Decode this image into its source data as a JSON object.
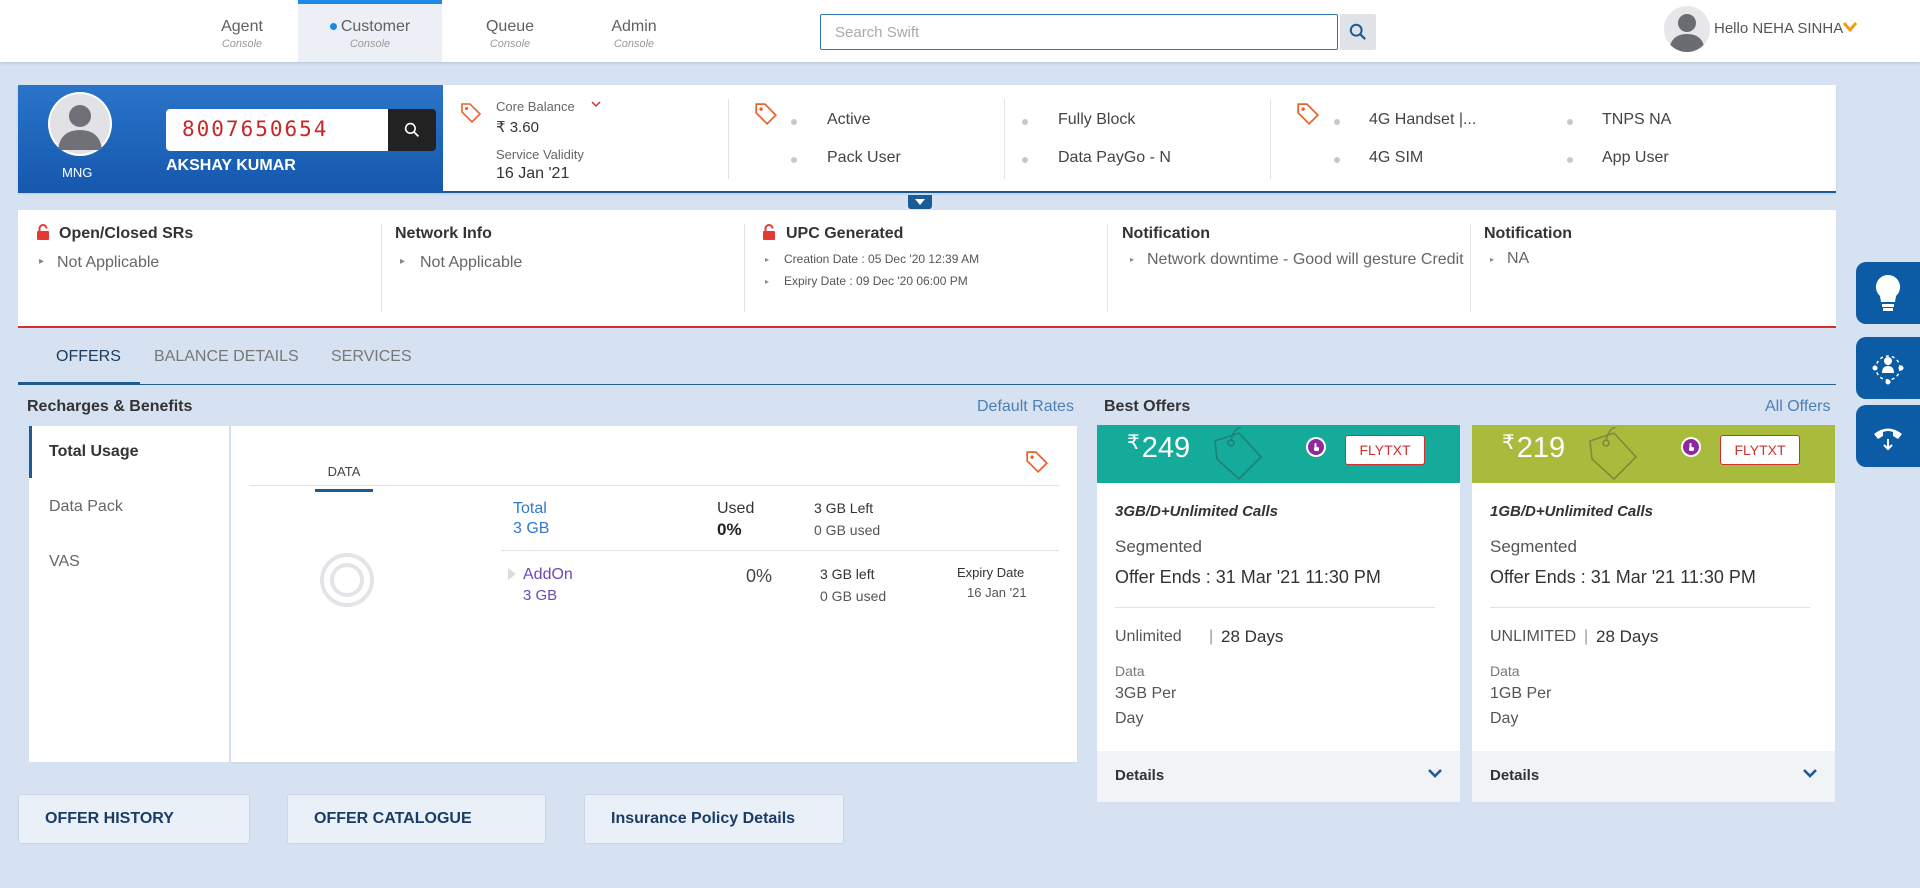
{
  "nav": {
    "tabs": [
      {
        "title": "Agent",
        "sub": "Console"
      },
      {
        "title": "Customer",
        "sub": "Console"
      },
      {
        "title": "Queue",
        "sub": "Console"
      },
      {
        "title": "Admin",
        "sub": "Console"
      }
    ],
    "search_placeholder": "Search Swift",
    "greeting": "Hello NEHA SINHA"
  },
  "customer": {
    "segment": "MNG",
    "msisdn": "8007650654",
    "name": "AKSHAY KUMAR",
    "core_balance_label": "Core Balance",
    "core_balance": "₹ 3.60",
    "service_validity_label": "Service Validity",
    "service_validity": "16 Jan '21",
    "status": [
      "Active",
      "Pack User",
      "Fully Block",
      "Data PayGo - N"
    ],
    "device": [
      "4G Handset |...",
      "4G SIM",
      "TNPS NA",
      "App User"
    ]
  },
  "info": {
    "srs_title": "Open/Closed SRs",
    "srs_value": "Not Applicable",
    "network_title": "Network Info",
    "network_value": "Not Applicable",
    "upc_title": "UPC Generated",
    "upc_creation": "Creation Date : 05 Dec '20 12:39 AM",
    "upc_expiry": "Expiry Date : 09 Dec '20 06:00 PM",
    "notif1_title": "Notification",
    "notif1_value": "Network downtime - Good will gesture Credit",
    "notif2_title": "Notification",
    "notif2_value": "NA"
  },
  "tabs": [
    "OFFERS",
    "BALANCE DETAILS",
    "SERVICES"
  ],
  "recharges": {
    "title": "Recharges & Benefits",
    "link": "Default Rates",
    "nav": [
      "Total Usage",
      "Data Pack",
      "VAS"
    ],
    "data_tab": "DATA",
    "total_label": "Total",
    "total_value": "3 GB",
    "used_label": "Used",
    "used_value": "0%",
    "left_label": "3 GB Left",
    "left_used": "0 GB used",
    "addon_label": "AddOn",
    "addon_value": "3 GB",
    "addon_pct": "0%",
    "addon_left": "3 GB left",
    "addon_used": "0 GB used",
    "expiry_label": "Expiry Date",
    "expiry_value": "16 Jan '21"
  },
  "best_offers": {
    "title": "Best Offers",
    "link": "All Offers",
    "cards": [
      {
        "currency": "₹",
        "price": "249",
        "badge": "FLYTXT",
        "name": "3GB/D+Unlimited Calls",
        "segment": "Segmented",
        "ends": "Offer Ends : 31 Mar '21 11:30 PM",
        "voice": "Unlimited",
        "validity": "28 Days",
        "data_label": "Data",
        "data_l1": "3GB Per",
        "data_l2": "Day",
        "details": "Details",
        "color": "#15ab9a"
      },
      {
        "currency": "₹",
        "price": "219",
        "badge": "FLYTXT",
        "name": "1GB/D+Unlimited Calls",
        "segment": "Segmented",
        "ends": "Offer Ends : 31 Mar '21 11:30 PM",
        "voice": "UNLIMITED",
        "validity": "28 Days",
        "data_label": "Data",
        "data_l1": "1GB Per",
        "data_l2": "Day",
        "details": "Details",
        "color": "#a9bb3c"
      }
    ]
  },
  "bottom": [
    "OFFER HISTORY",
    "OFFER CATALOGUE",
    "Insurance Policy Details"
  ],
  "colors": {
    "brand_blue": "#1c5c94",
    "accent_red": "#d32f2f"
  }
}
